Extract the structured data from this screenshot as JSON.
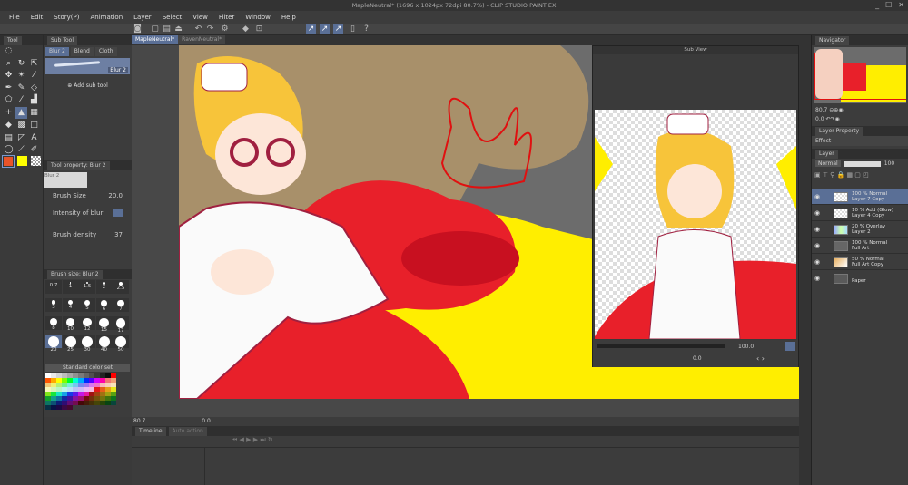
{
  "window": {
    "title": "MapleNeutral* (1696 x 1024px 72dpi 80.7%) - CLIP STUDIO PAINT EX",
    "controls": [
      "_",
      "☐",
      "✕"
    ]
  },
  "menu": [
    "File",
    "Edit",
    "Story(P)",
    "Animation",
    "Layer",
    "Select",
    "View",
    "Filter",
    "Window",
    "Help"
  ],
  "left": {
    "tool_tab": "Tool",
    "subtool_tab": "Sub Tool",
    "subtool_groups": [
      "Blur 2",
      "Blend",
      "Cloth"
    ],
    "selected_subtool": "Blur 2",
    "add_sub_tool": "Add sub tool",
    "tool_property_tab": "Tool property: Blur 2",
    "preview_label": "Blur 2",
    "props": [
      {
        "label": "Brush Size",
        "value": "20.0"
      },
      {
        "label": "Intensity of blur",
        "value": ""
      },
      {
        "label": "Brush density",
        "value": "37"
      }
    ],
    "brush_size_tab": "Brush size: Blur 2",
    "brush_sizes": [
      "0.7",
      "1",
      "1.5",
      "2",
      "2.5",
      "3",
      "4",
      "5",
      "6",
      "7",
      "8",
      "10",
      "12",
      "15",
      "17",
      "20",
      "25",
      "30",
      "40",
      "50"
    ],
    "selected_brush_size": "20",
    "color_set": "Standard color set",
    "main_color": "#e8542a",
    "sub_color": "#ffff00"
  },
  "tabs": [
    {
      "label": "MapleNeutral*",
      "active": true
    },
    {
      "label": "RavenNeutral*",
      "active": false
    }
  ],
  "subview": {
    "title": "Sub View",
    "zoom": "100.0",
    "angle": "0.0"
  },
  "status": {
    "zoom": "80.7",
    "angle": "0.0"
  },
  "timeline": {
    "tabs": [
      "Timeline",
      "Auto action"
    ]
  },
  "right": {
    "navigator_tab": "Navigator",
    "nav_zoom": "80.7",
    "nav_angle": "0.0",
    "layer_property_tab": "Layer Property",
    "effect_label": "Effect",
    "layer_tab": "Layer",
    "blend_mode": "Normal",
    "opacity": "100",
    "layers": [
      {
        "line1": "100 % Normal",
        "line2": "Layer 7 Copy",
        "selected": true,
        "thumb": "checker"
      },
      {
        "line1": "10 % Add (Glow)",
        "line2": "Layer 4 Copy",
        "selected": false,
        "thumb": "checker"
      },
      {
        "line1": "20 % Overlay",
        "line2": "Layer 2",
        "selected": false,
        "thumb": "gradient"
      },
      {
        "line1": "100 % Normal",
        "line2": "Full Art",
        "selected": false,
        "thumb": "folder"
      },
      {
        "line1": "50 % Normal",
        "line2": "Full Art Copy",
        "selected": false,
        "thumb": "art"
      },
      {
        "line1": "",
        "line2": "Paper",
        "selected": false,
        "thumb": "gray"
      }
    ]
  },
  "colors": {
    "accent": "#5a6f96",
    "canvas_bg": "#6c6c6c",
    "red": "#e8202a",
    "yellow": "#ffee00",
    "tan": "#a8906a"
  }
}
